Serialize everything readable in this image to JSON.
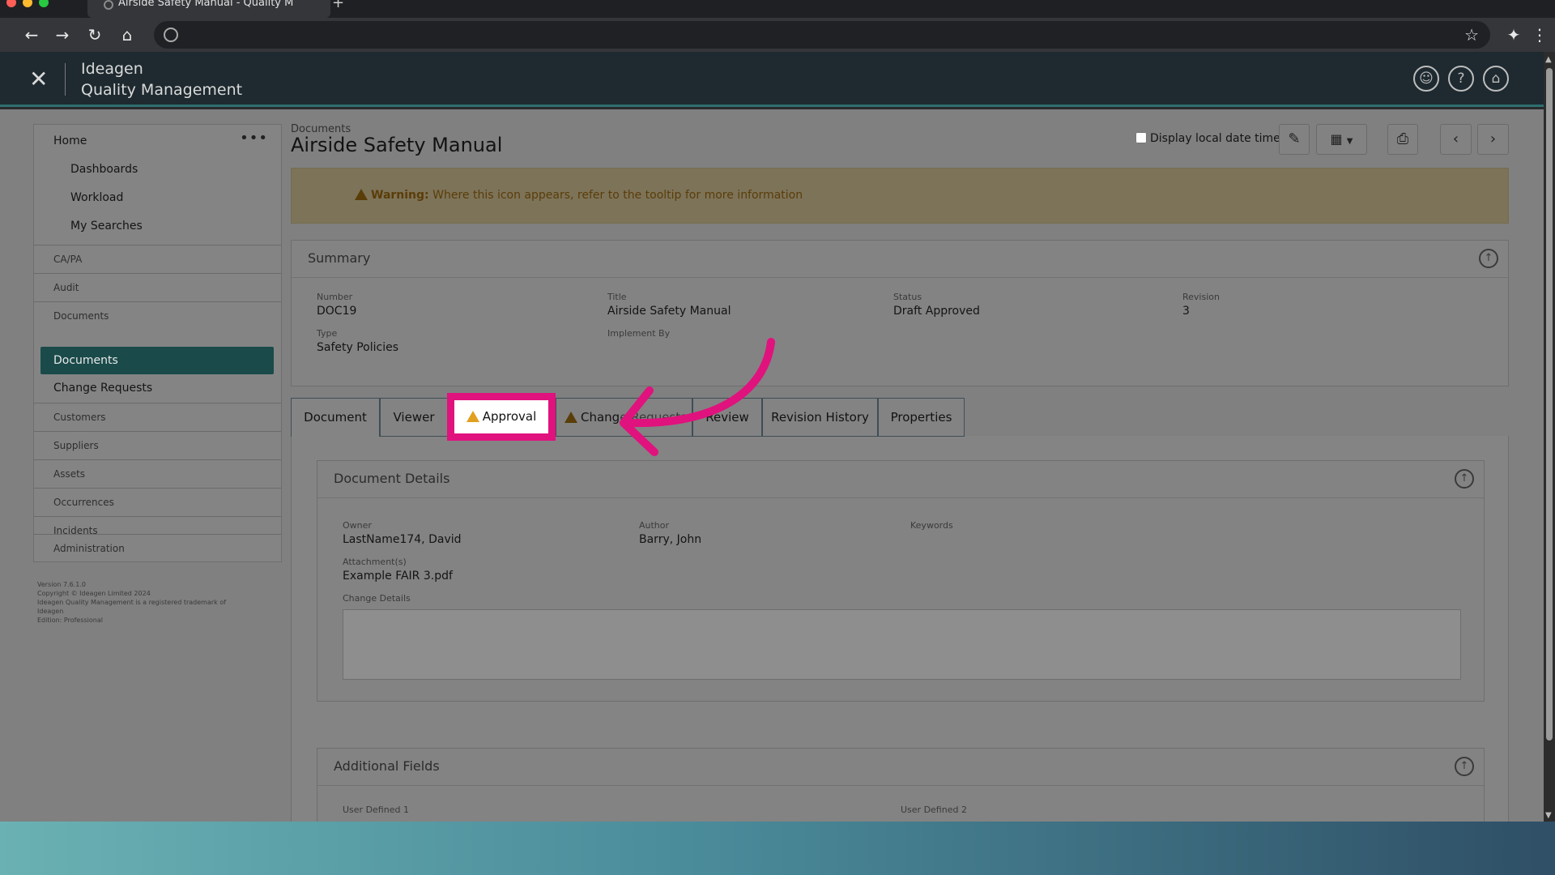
{
  "browser": {
    "tab_title": "Airside Safety Manual - Quality M",
    "new_tab": "+"
  },
  "header": {
    "brand_line1": "Ideagen",
    "brand_line2": "Quality Management",
    "close_symbol": "✕"
  },
  "sidebar": {
    "home": "Home",
    "more": "•••",
    "sub_items": [
      "Dashboards",
      "Workload",
      "My Searches"
    ],
    "sections": [
      "CA/PA",
      "Audit",
      "Documents",
      "Customers",
      "Suppliers",
      "Assets",
      "Occurrences",
      "Incidents",
      "Administration"
    ],
    "active": "Documents",
    "change_requests": "Change Requests",
    "version_lines": [
      "Version 7.6.1.0",
      "Copyright © Ideagen Limited 2024",
      "Ideagen Quality Management is a registered trademark of",
      "Ideagen",
      "Edition: Professional"
    ]
  },
  "main": {
    "breadcrumb": "Documents",
    "title": "Airside Safety Manual",
    "display_local": "Display local date time",
    "warning_label": "Warning:",
    "warning_text": "Where this icon appears, refer to the tooltip for more information"
  },
  "summary": {
    "heading": "Summary",
    "number_label": "Number",
    "number": "DOC19",
    "title_label": "Title",
    "title": "Airside Safety Manual",
    "status_label": "Status",
    "status": "Draft Approved",
    "revision_label": "Revision",
    "revision": "3",
    "type_label": "Type",
    "type": "Safety Policies",
    "implement_label": "Implement By"
  },
  "tabs": {
    "document": "Document",
    "viewer": "Viewer",
    "approval": "Approval",
    "change": "Chang",
    "change_hidden": "e Requests",
    "review": "Review",
    "revision_history": "Revision History",
    "properties": "Properties"
  },
  "document_details": {
    "heading": "Document Details",
    "owner_label": "Owner",
    "owner": "LastName174, David",
    "author_label": "Author",
    "author": "Barry, John",
    "keywords_label": "Keywords",
    "attach_label": "Attachment(s)",
    "attachment": "Example FAIR 3.pdf",
    "change_label": "Change Details"
  },
  "additional_fields": {
    "heading": "Additional Fields",
    "ud1": "User Defined 1",
    "ud2": "User Defined 2"
  },
  "colors": {
    "highlight": "#e0127d",
    "active_nav": "#1a4a4a",
    "warning_icon": "#e2a020"
  }
}
